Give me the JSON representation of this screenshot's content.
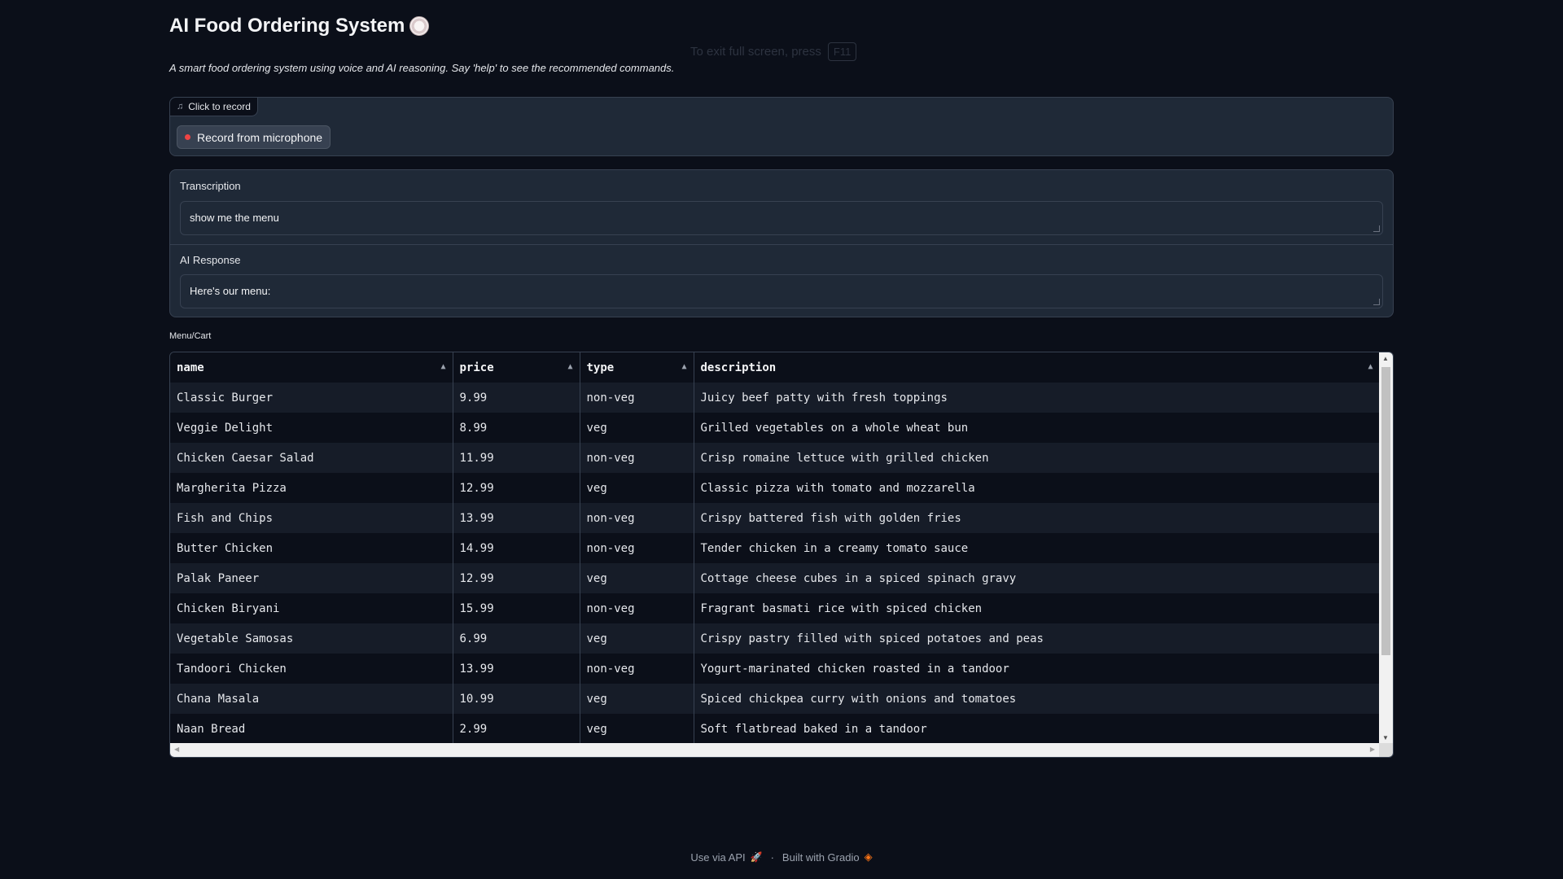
{
  "header": {
    "title": "AI Food Ordering System",
    "subtitle": "A smart food ordering system using voice and AI reasoning. Say 'help' to see the recommended commands."
  },
  "fullscreen_hint": {
    "text": "To exit full screen, press",
    "key": "F11"
  },
  "audio": {
    "label": "Click to record",
    "record_button": "Record from microphone"
  },
  "transcription": {
    "label": "Transcription",
    "value": "show me the menu"
  },
  "ai_response": {
    "label": "AI Response",
    "value": "Here's our menu:"
  },
  "menu_cart": {
    "label": "Menu/Cart",
    "columns": [
      "name",
      "price",
      "type",
      "description"
    ],
    "rows": [
      [
        "Classic Burger",
        "9.99",
        "non-veg",
        "Juicy beef patty with fresh toppings"
      ],
      [
        "Veggie Delight",
        "8.99",
        "veg",
        "Grilled vegetables on a whole wheat bun"
      ],
      [
        "Chicken Caesar Salad",
        "11.99",
        "non-veg",
        "Crisp romaine lettuce with grilled chicken"
      ],
      [
        "Margherita Pizza",
        "12.99",
        "veg",
        "Classic pizza with tomato and mozzarella"
      ],
      [
        "Fish and Chips",
        "13.99",
        "non-veg",
        "Crispy battered fish with golden fries"
      ],
      [
        "Butter Chicken",
        "14.99",
        "non-veg",
        "Tender chicken in a creamy tomato sauce"
      ],
      [
        "Palak Paneer",
        "12.99",
        "veg",
        "Cottage cheese cubes in a spiced spinach gravy"
      ],
      [
        "Chicken Biryani",
        "15.99",
        "non-veg",
        "Fragrant basmati rice with spiced chicken"
      ],
      [
        "Vegetable Samosas",
        "6.99",
        "veg",
        "Crispy pastry filled with spiced potatoes and peas"
      ],
      [
        "Tandoori Chicken",
        "13.99",
        "non-veg",
        "Yogurt-marinated chicken roasted in a tandoor"
      ],
      [
        "Chana Masala",
        "10.99",
        "veg",
        "Spiced chickpea curry with onions and tomatoes"
      ],
      [
        "Naan Bread",
        "2.99",
        "veg",
        "Soft flatbread baked in a tandoor"
      ]
    ]
  },
  "footer": {
    "api_link": "Use via API",
    "separator": "·",
    "built_with": "Built with Gradio"
  },
  "icons": {
    "title": "plate-icon",
    "audio_label": "music-note-icon",
    "api": "rocket-icon",
    "gradio": "gradio-logo-icon"
  },
  "colors": {
    "background": "#0b0f19",
    "panel": "#1f2937",
    "border": "#374151",
    "record_dot": "#ef4444",
    "accent": "#f97316"
  }
}
